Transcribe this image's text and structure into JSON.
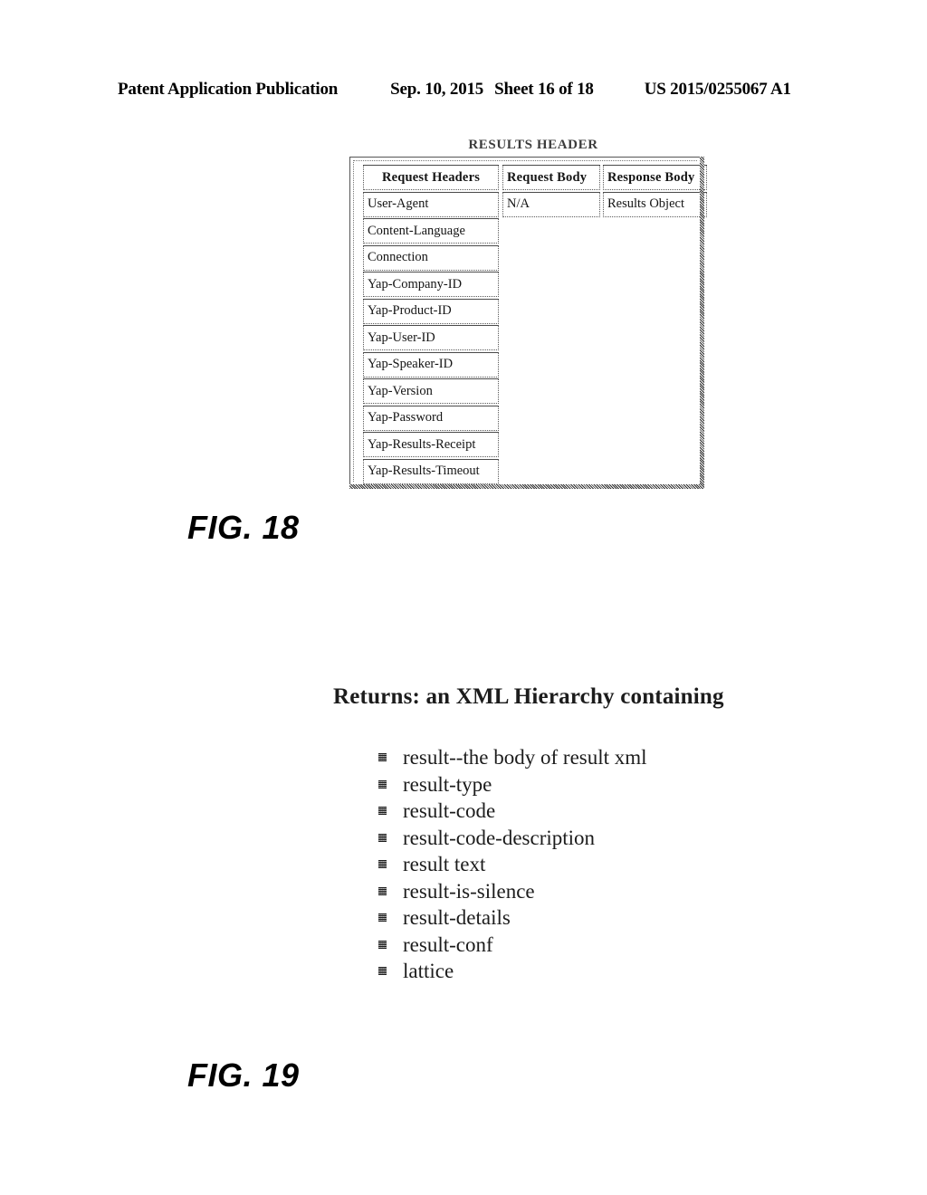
{
  "page_header": {
    "publication": "Patent Application Publication",
    "date": "Sep. 10, 2015",
    "sheet": "Sheet 16 of 18",
    "document_number": "US 2015/0255067 A1"
  },
  "figure_18": {
    "label": "FIG. 18",
    "title": "RESULTS HEADER",
    "columns": [
      {
        "header": "Request Headers",
        "cells": [
          "User-Agent",
          "Content-Language",
          "Connection",
          "Yap-Company-ID",
          "Yap-Product-ID",
          "Yap-User-ID",
          "Yap-Speaker-ID",
          "Yap-Version",
          "Yap-Password",
          "Yap-Results-Receipt",
          "Yap-Results-Timeout"
        ]
      },
      {
        "header": "Request Body",
        "cells": [
          "N/A"
        ]
      },
      {
        "header": "Response Body",
        "cells": [
          "Results Object"
        ]
      }
    ]
  },
  "figure_19": {
    "label": "FIG. 19",
    "heading": "Returns: an XML Hierarchy containing",
    "items": [
      "result--the body of result xml",
      "result-type",
      "result-code",
      "result-code-description",
      "result text",
      "result-is-silence",
      "result-details",
      "result-conf",
      "lattice"
    ]
  }
}
